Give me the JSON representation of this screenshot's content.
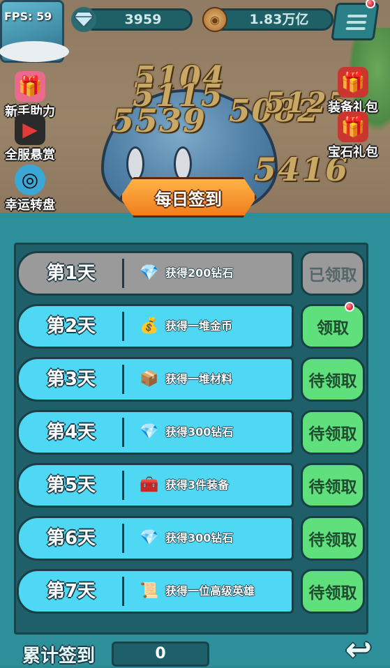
{
  "hud": {
    "fps": "FPS: 59",
    "diamonds": "3959",
    "gold": "1.83万亿"
  },
  "battle": {
    "damage_numbers": [
      "5104",
      "5115",
      "5539",
      "5082",
      "5125",
      "5416"
    ]
  },
  "side_left": [
    {
      "label": "新手助力",
      "icon": "gift-icon"
    },
    {
      "label": "全服悬赏",
      "icon": "bounty-icon"
    },
    {
      "label": "幸运转盘",
      "icon": "wheel-icon"
    }
  ],
  "side_right": [
    {
      "label": "装备礼包",
      "icon": "gift-icon"
    },
    {
      "label": "宝石礼包",
      "icon": "gem-gift-icon"
    }
  ],
  "panel": {
    "title": "每日签到",
    "rows": [
      {
        "day": "第1天",
        "reward": "获得200钻石",
        "icon": "diamond-icon",
        "button": "已领取",
        "state": "claimed"
      },
      {
        "day": "第2天",
        "reward": "获得一堆金币",
        "icon": "coin-bag-icon",
        "button": "领取",
        "state": "available"
      },
      {
        "day": "第3天",
        "reward": "获得一堆材料",
        "icon": "material-box-icon",
        "button": "待领取",
        "state": "pending"
      },
      {
        "day": "第4天",
        "reward": "获得300钻石",
        "icon": "diamond-icon",
        "button": "待领取",
        "state": "pending"
      },
      {
        "day": "第5天",
        "reward": "获得3件装备",
        "icon": "chest-icon",
        "button": "待领取",
        "state": "pending"
      },
      {
        "day": "第6天",
        "reward": "获得300钻石",
        "icon": "diamond-icon",
        "button": "待领取",
        "state": "pending"
      },
      {
        "day": "第7天",
        "reward": "获得一位高级英雄",
        "icon": "scroll-icon",
        "button": "待领取",
        "state": "pending"
      }
    ]
  },
  "footer": {
    "total_label": "累计签到",
    "total_value": "0"
  },
  "colors": {
    "row_active": "#4fd8f3",
    "row_claimed": "#9a9a9a",
    "button_green": "#5fe07d",
    "banner_orange": "#f07d1d"
  }
}
